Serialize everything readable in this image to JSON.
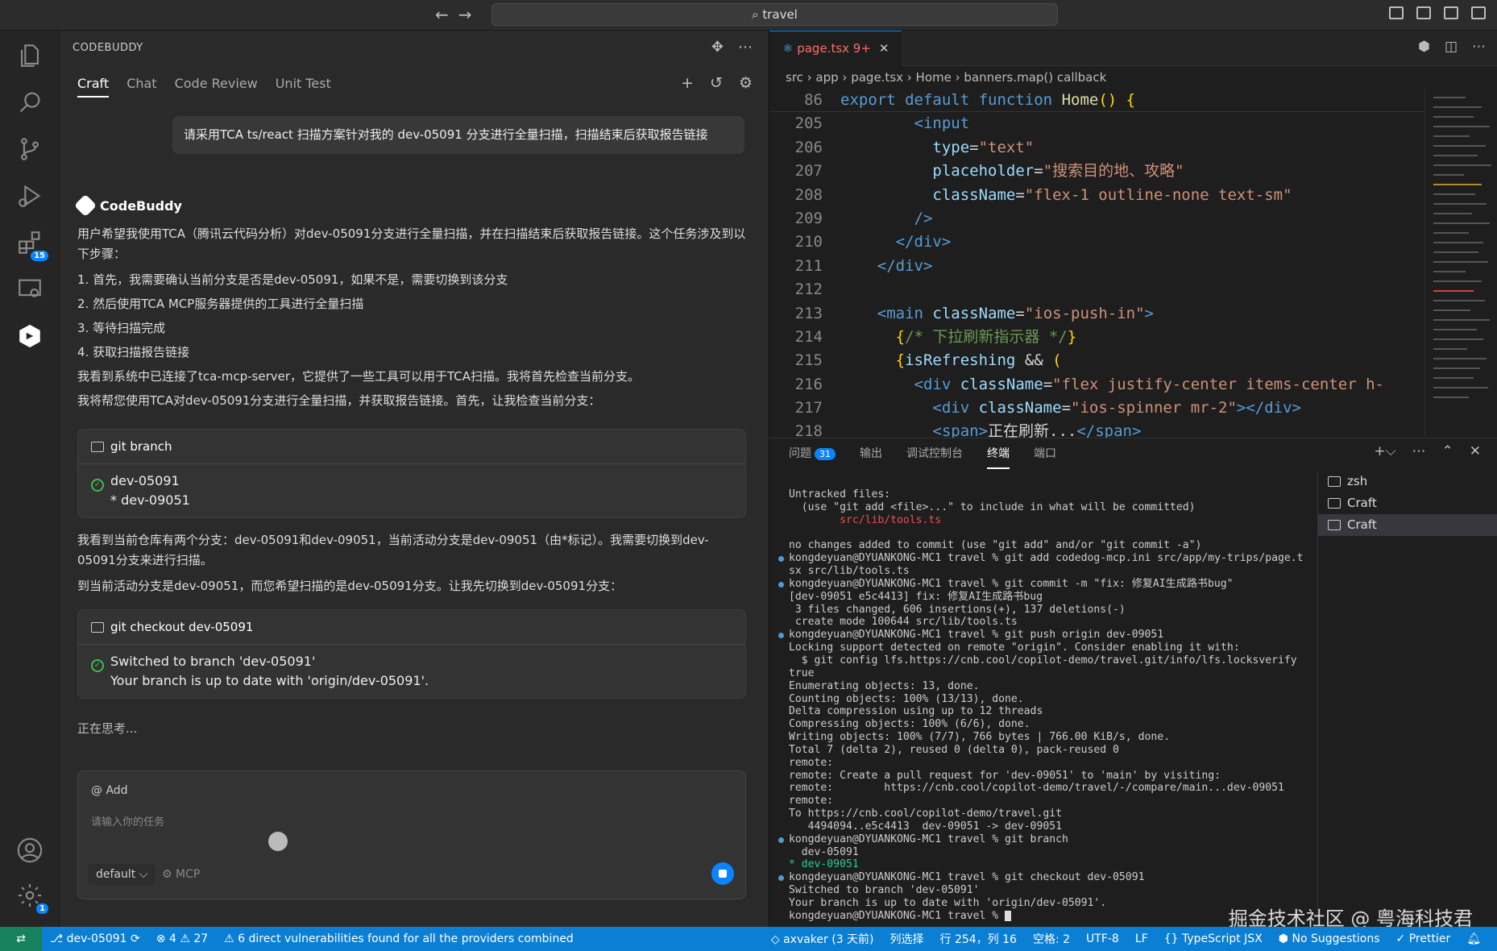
{
  "titlebar": {
    "search_text": "travel",
    "back_icon": "←",
    "forward_icon": "→"
  },
  "activity_bar": {
    "extensions_badge": "15",
    "settings_badge": "1"
  },
  "sidebar": {
    "title": "CODEBUDDY",
    "tabs": [
      "Craft",
      "Chat",
      "Code Review",
      "Unit Test"
    ],
    "active_tab": "Craft",
    "user_message": "请采用TCA ts/react  扫描方案针对我的 dev-05091 分支进行全量扫描，扫描结束后获取报告链接",
    "bot_name": "CodeBuddy",
    "paragraphs": [
      "用户希望我使用TCA（腾讯云代码分析）对dev-05091分支进行全量扫描，并在扫描结束后获取报告链接。这个任务涉及到以下步骤：",
      "1. 首先，我需要确认当前分支是否是dev-05091，如果不是，需要切换到该分支",
      "2. 然后使用TCA MCP服务器提供的工具进行全量扫描",
      "3. 等待扫描完成",
      "4. 获取扫描报告链接",
      "我看到系统中已连接了tca-mcp-server，它提供了一些工具可以用于TCA扫描。我将首先检查当前分支。",
      "我将帮您使用TCA对dev-05091分支进行全量扫描，并获取报告链接。首先，让我检查当前分支：",
      "我看到当前仓库有两个分支：dev-05091和dev-09051，当前活动分支是dev-09051（由*标记）。我需要切换到dev-05091分支来进行扫描。",
      "到当前活动分支是dev-09051，而您希望扫描的是dev-05091分支。让我先切换到dev-05091分支："
    ],
    "cmd1": {
      "title": "git branch",
      "lines": [
        "dev-05091",
        "* dev-09051"
      ]
    },
    "cmd2": {
      "title": "git checkout dev-05091",
      "lines": [
        "Switched to branch 'dev-05091'",
        "Your branch is up to date with 'origin/dev-05091'."
      ]
    },
    "thinking": "正在思考...",
    "input": {
      "add_label": "@ Add",
      "placeholder": "请输入你的任务",
      "mode": "default ⌵",
      "mcp": "⚙ MCP"
    }
  },
  "editor": {
    "tab_label": "page.tsx  9+",
    "breadcrumb": "src  ›  app  ›  page.tsx  ›  Home  ›  banners.map() callback",
    "sticky_line": {
      "num": "86"
    },
    "line_numbers": [
      "205",
      "206",
      "207",
      "208",
      "209",
      "210",
      "211",
      "212",
      "213",
      "214",
      "215",
      "216",
      "217",
      "218"
    ]
  },
  "panel": {
    "tabs": [
      "问题",
      "输出",
      "调试控制台",
      "终端",
      "端口"
    ],
    "problems_count": "31",
    "active_tab": "终端",
    "terminal_lines": [
      "Untracked files:",
      "  (use \"git add <file>...\" to include in what will be committed)",
      "        src/lib/tools.ts",
      "",
      "no changes added to commit (use \"git add\" and/or \"git commit -a\")",
      "kongdeyuan@DYUANKONG-MC1 travel % git add codedog-mcp.ini src/app/my-trips/page.t",
      "sx src/lib/tools.ts",
      "kongdeyuan@DYUANKONG-MC1 travel % git commit -m \"fix: 修复AI生成路书bug\"",
      "[dev-09051 e5c4413] fix: 修复AI生成路书bug",
      " 3 files changed, 606 insertions(+), 137 deletions(-)",
      " create mode 100644 src/lib/tools.ts",
      "kongdeyuan@DYUANKONG-MC1 travel % git push origin dev-09051",
      "Locking support detected on remote \"origin\". Consider enabling it with:",
      "  $ git config lfs.https://cnb.cool/copilot-demo/travel.git/info/lfs.locksverify",
      "true",
      "Enumerating objects: 13, done.",
      "Counting objects: 100% (13/13), done.",
      "Delta compression using up to 12 threads",
      "Compressing objects: 100% (6/6), done.",
      "Writing objects: 100% (7/7), 766 bytes | 766.00 KiB/s, done.",
      "Total 7 (delta 2), reused 0 (delta 0), pack-reused 0",
      "remote:",
      "remote: Create a pull request for 'dev-09051' to 'main' by visiting:",
      "remote:        https://cnb.cool/copilot-demo/travel/-/compare/main...dev-09051",
      "remote:",
      "To https://cnb.cool/copilot-demo/travel.git",
      "   4494094..e5c4413  dev-09051 -> dev-09051",
      "kongdeyuan@DYUANKONG-MC1 travel % git branch",
      "  dev-05091",
      "* dev-09051",
      "kongdeyuan@DYUANKONG-MC1 travel % git checkout dev-05091",
      "Switched to branch 'dev-05091'",
      "Your branch is up to date with 'origin/dev-05091'.",
      "kongdeyuan@DYUANKONG-MC1 travel % "
    ],
    "terminal_list": [
      "zsh",
      "Craft",
      "Craft"
    ]
  },
  "watermark": "掘金技术社区 @ 粤海科技君",
  "statusbar": {
    "branch": "dev-05091",
    "errors": "4",
    "warnings": "27",
    "vuln": "6 direct vulnerabilities found for all the providers combined",
    "author": "axvaker (3 天前)",
    "select_mode": "列选择",
    "position": "行 254，列 16",
    "spaces": "空格: 2",
    "encoding": "UTF-8",
    "eol": "LF",
    "language": "TypeScript JSX",
    "suggestions": "No Suggestions",
    "prettier": "Prettier"
  }
}
